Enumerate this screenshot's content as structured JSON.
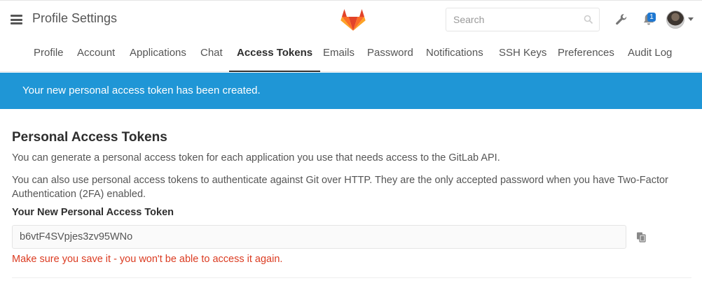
{
  "header": {
    "page_title": "Profile Settings",
    "logo_icon": "gitlab-tanuki-logo",
    "search": {
      "placeholder": "Search",
      "value": ""
    },
    "notifications_count": "1",
    "icons": [
      "menu-icon",
      "search-icon",
      "wrench-icon",
      "bell-icon",
      "avatar",
      "chevron-down-icon"
    ]
  },
  "nav": {
    "tabs": [
      {
        "label": "Profile",
        "active": false
      },
      {
        "label": "Account",
        "active": false
      },
      {
        "label": "Applications",
        "active": false
      },
      {
        "label": "Chat",
        "active": false
      },
      {
        "label": "Access Tokens",
        "active": true
      },
      {
        "label": "Emails",
        "active": false
      },
      {
        "label": "Password",
        "active": false
      },
      {
        "label": "Notifications",
        "active": false
      },
      {
        "label": "SSH Keys",
        "active": false
      },
      {
        "label": "Preferences",
        "active": false
      },
      {
        "label": "Audit Log",
        "active": false
      }
    ]
  },
  "flash": {
    "message": "Your new personal access token has been created."
  },
  "main": {
    "title": "Personal Access Tokens",
    "paragraph1": "You can generate a personal access token for each application you use that needs access to the GitLab API.",
    "paragraph2": "You can also use personal access tokens to authenticate against Git over HTTP. They are the only accepted password when you have Two-Factor Authentication (2FA) enabled.",
    "token_label": "Your New Personal Access Token",
    "token_value": "b6vtF4SVpjes3zv95WNo",
    "warning": "Make sure you save it - you won't be able to access it again."
  },
  "colors": {
    "flash_bg": "#1f96d6",
    "warning_text": "#db3b21",
    "badge_bg": "#1f78d1",
    "logo_orange": "#e24329",
    "logo_light": "#fca326",
    "logo_mid": "#fc6d26"
  }
}
